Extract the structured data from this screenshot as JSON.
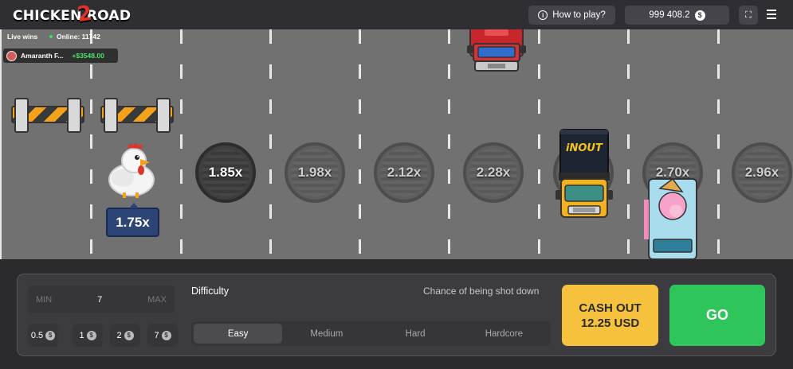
{
  "header": {
    "logo_part1": "CHICKEN",
    "logo_digit": "2",
    "logo_part2": "ROAD",
    "how_to_play": "How to play?",
    "balance": "999 408.2",
    "currency_symbol": "$"
  },
  "live": {
    "label": "Live wins",
    "online": "Online: 11742",
    "latest_win": {
      "name": "Amaranth F...",
      "amount": "+$3548.00"
    }
  },
  "lanes": {
    "chicken_multiplier": "1.75x",
    "multipliers": [
      "1.85x",
      "1.98x",
      "2.12x",
      "2.28x",
      "2.70x",
      "2.96x"
    ]
  },
  "truck_label": "iNOUT",
  "controls": {
    "bet": {
      "min_label": "MIN",
      "value": "7",
      "max_label": "MAX"
    },
    "quick_bets": [
      "0.5",
      "1",
      "2",
      "7"
    ],
    "difficulty_title": "Difficulty",
    "chance_label": "Chance of being shot down",
    "difficulties": [
      "Easy",
      "Medium",
      "Hard",
      "Hardcore"
    ],
    "selected_difficulty": "Easy",
    "cashout_line1": "CASH OUT",
    "cashout_line2": "12.25 USD",
    "go_label": "GO"
  },
  "colors": {
    "road": "#717171",
    "cashout": "#f6c23e",
    "go": "#2ec65a",
    "badge": "#2c4476",
    "win_green": "#4be36b"
  }
}
